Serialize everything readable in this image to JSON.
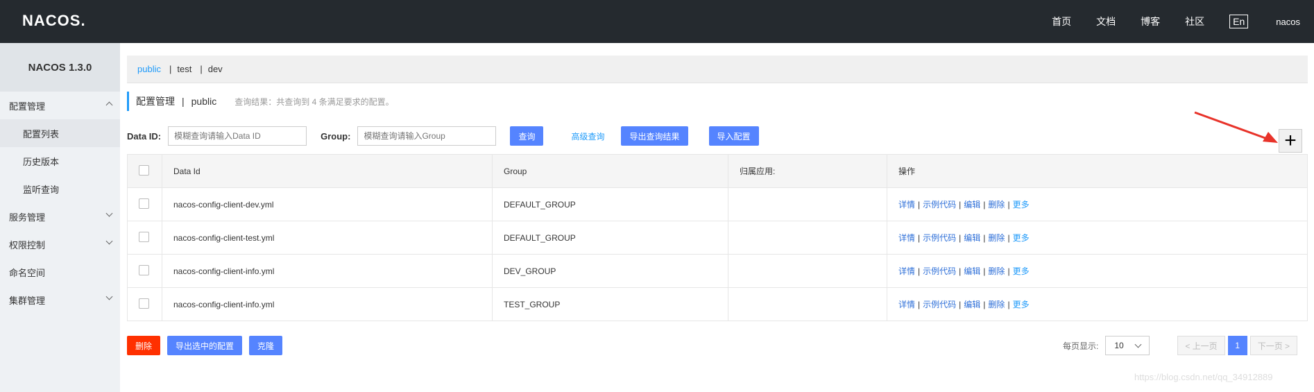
{
  "header": {
    "logo": "NACOS.",
    "nav": [
      "首页",
      "文档",
      "博客",
      "社区"
    ],
    "lang": "En",
    "user": "nacos"
  },
  "sidebar": {
    "title": "NACOS 1.3.0",
    "groups": [
      {
        "label": "配置管理",
        "expanded": true,
        "children": [
          "配置列表",
          "历史版本",
          "监听查询"
        ]
      },
      {
        "label": "服务管理",
        "expanded": false
      },
      {
        "label": "权限控制",
        "expanded": false
      },
      {
        "label": "命名空间"
      },
      {
        "label": "集群管理",
        "expanded": false
      }
    ],
    "active": "配置列表"
  },
  "namespaces": [
    "public",
    "test",
    "dev"
  ],
  "active_namespace": "public",
  "page": {
    "title": "配置管理",
    "namespace": "public",
    "result_hint": "查询结果：共查询到 4 条满足要求的配置。"
  },
  "filter": {
    "dataid_label": "Data ID:",
    "dataid_placeholder": "模糊查询请输入Data ID",
    "group_label": "Group:",
    "group_placeholder": "模糊查询请输入Group",
    "search": "查询",
    "advanced": "高级查询",
    "export_result": "导出查询结果",
    "import": "导入配置"
  },
  "add_button": "+",
  "table": {
    "headers": [
      "Data Id",
      "Group",
      "归属应用:",
      "操作"
    ],
    "rows": [
      {
        "data_id": "nacos-config-client-dev.yml",
        "group": "DEFAULT_GROUP",
        "app": ""
      },
      {
        "data_id": "nacos-config-client-test.yml",
        "group": "DEFAULT_GROUP",
        "app": ""
      },
      {
        "data_id": "nacos-config-client-info.yml",
        "group": "DEV_GROUP",
        "app": ""
      },
      {
        "data_id": "nacos-config-client-info.yml",
        "group": "TEST_GROUP",
        "app": ""
      }
    ],
    "ops": [
      "详情",
      "示例代码",
      "编辑",
      "删除",
      "更多"
    ]
  },
  "footer": {
    "delete": "删除",
    "export_selected": "导出选中的配置",
    "clone": "克隆"
  },
  "pager": {
    "per_page_label": "每页显示:",
    "per_page": "10",
    "prev": "< 上一页",
    "current": "1",
    "next": "下一页 >"
  },
  "watermark": "https://blog.csdn.net/qq_34912889",
  "colors": {
    "primary": "#5584ff",
    "danger": "#ff3000",
    "link": "#209bfa",
    "header": "#252a2f"
  }
}
